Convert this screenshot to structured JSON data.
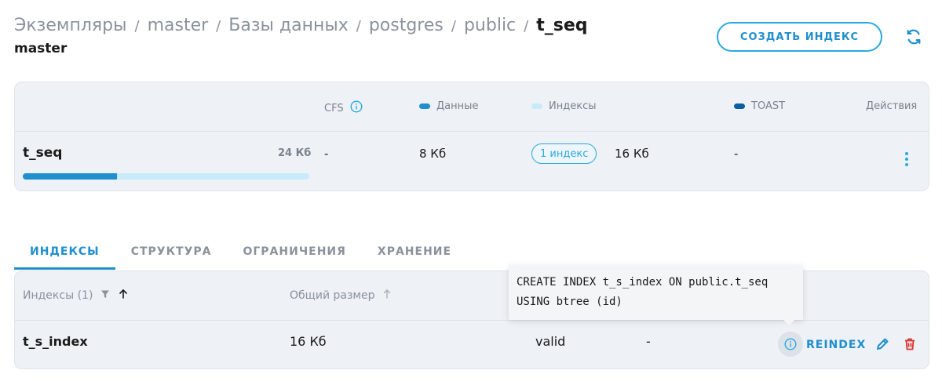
{
  "header": {
    "breadcrumb": [
      {
        "label": "Экземпляры"
      },
      {
        "label": "master"
      },
      {
        "label": "Базы данных"
      },
      {
        "label": "postgres"
      },
      {
        "label": "public"
      }
    ],
    "separator": "/",
    "current": "t_seq",
    "subtitle": "master",
    "create_button": "СОЗДАТЬ ИНДЕКС",
    "refresh_icon": "refresh-icon"
  },
  "summary": {
    "columns": {
      "cfs": "CFS",
      "data": "Данные",
      "indexes": "Индексы",
      "toast": "TOAST",
      "actions": "Действия"
    },
    "row": {
      "name": "t_seq",
      "total_size": "24 Кб",
      "cfs": "-",
      "data": "8 Кб",
      "index_count": "1 индекс",
      "indexes": "16 Кб",
      "toast": "-",
      "data_fraction": 0.33
    },
    "colors": {
      "data": "#1f8fce",
      "indexes": "#c8ebfa",
      "toast": "#0a5fa3"
    }
  },
  "tabs": [
    {
      "label": "ИНДЕКСЫ",
      "active": true
    },
    {
      "label": "СТРУКТУРА",
      "active": false
    },
    {
      "label": "ОГРАНИЧЕНИЯ",
      "active": false
    },
    {
      "label": "ХРАНЕНИЕ",
      "active": false
    }
  ],
  "index_table": {
    "headers": {
      "name": "Индексы (1)",
      "size": "Общий размер"
    },
    "rows": [
      {
        "name": "t_s_index",
        "size": "16 Кб",
        "status": "valid",
        "extra": "-"
      }
    ],
    "reindex_label": "REINDEX"
  },
  "tooltip": {
    "text": "CREATE INDEX t_s_index ON public.t_seq\nUSING btree (id)"
  }
}
